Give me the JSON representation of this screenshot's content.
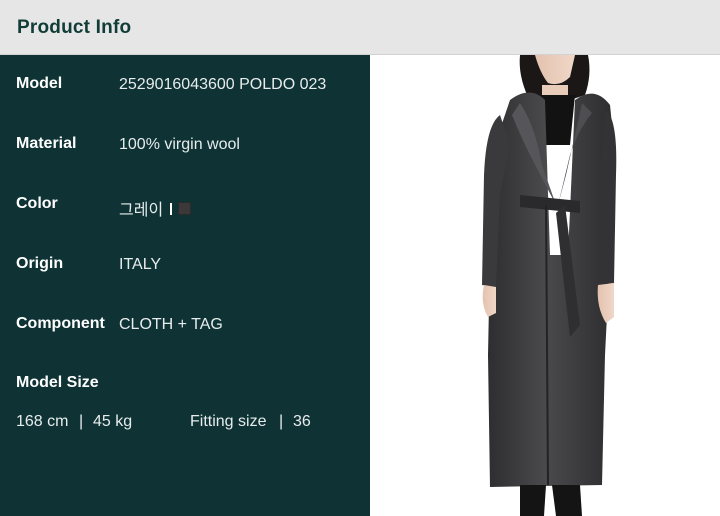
{
  "header": {
    "title": "Product Info"
  },
  "info": {
    "model": {
      "label": "Model",
      "value": "2529016043600 POLDO 023"
    },
    "material": {
      "label": "Material",
      "value": "100% virgin wool"
    },
    "color": {
      "label": "Color",
      "value": "그레이",
      "swatch": "#3a3838"
    },
    "origin": {
      "label": "Origin",
      "value": "ITALY"
    },
    "component": {
      "label": "Component",
      "value": "CLOTH + TAG"
    }
  },
  "model_size": {
    "label": "Model Size",
    "height": "168 cm",
    "separator": "|",
    "weight": "45 kg",
    "fitting_label": "Fitting size",
    "fitting_value": "36"
  },
  "photo": {
    "subject": "model-wearing-long-charcoal-wrap-coat"
  },
  "colors": {
    "panel": "#0f3335",
    "header_bg": "#e6e6e6",
    "header_text": "#123c38"
  }
}
